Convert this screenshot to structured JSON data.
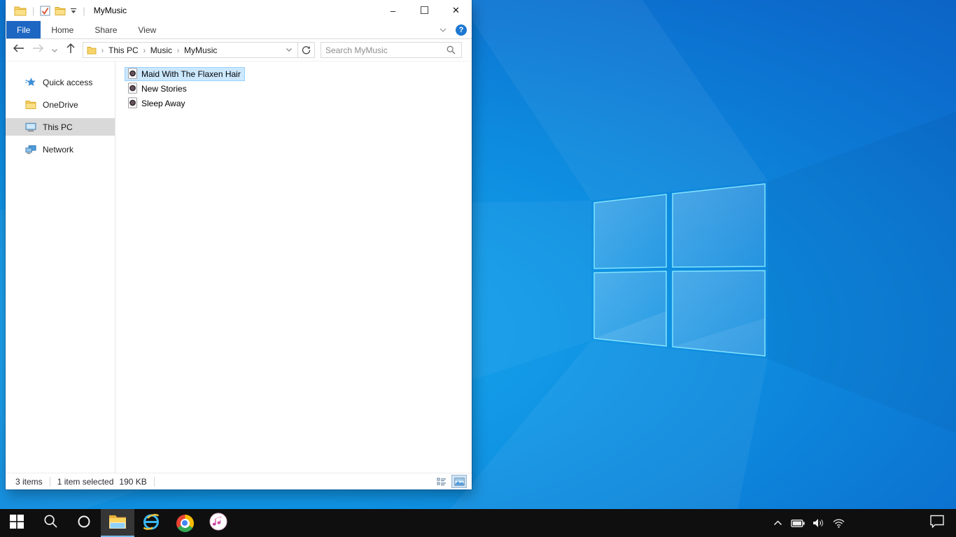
{
  "window": {
    "title": "MyMusic",
    "quick_access_toolbar": {
      "icons": [
        "file-explorer-icon",
        "properties-check-icon",
        "new-folder-icon",
        "qat-dropdown-icon"
      ]
    },
    "controls": {
      "minimize": "–",
      "maximize": "☐",
      "close": "✕"
    }
  },
  "ribbon": {
    "tabs": [
      "File",
      "Home",
      "Share",
      "View"
    ],
    "active_tab": "File",
    "right_icons": [
      "collapse-ribbon-chevron-icon",
      "help-icon"
    ],
    "help_label": "?"
  },
  "navigation": {
    "icons": [
      "back-icon",
      "forward-icon",
      "recent-locations-chevron-icon",
      "up-icon"
    ]
  },
  "address_bar": {
    "crumbs": [
      "This PC",
      "Music",
      "MyMusic"
    ],
    "separator": "›",
    "icons": [
      "folder-icon",
      "dropdown-chevron-icon",
      "refresh-icon"
    ]
  },
  "search": {
    "placeholder": "Search MyMusic",
    "icon": "magnifier-icon"
  },
  "sidebar": {
    "items": [
      {
        "label": "Quick access",
        "icon": "quick-access-star-icon",
        "selected": false
      },
      {
        "label": "OneDrive",
        "icon": "onedrive-folder-icon",
        "selected": false
      },
      {
        "label": "This PC",
        "icon": "this-pc-monitor-icon",
        "selected": true
      },
      {
        "label": "Network",
        "icon": "network-icon",
        "selected": false
      }
    ]
  },
  "file_list": {
    "items": [
      {
        "name": "Maid With The Flaxen Hair",
        "icon": "audio-file-icon",
        "selected": true
      },
      {
        "name": "New Stories",
        "icon": "audio-file-icon",
        "selected": false
      },
      {
        "name": "Sleep Away",
        "icon": "audio-file-icon",
        "selected": false
      }
    ]
  },
  "status_bar": {
    "items_count": "3 items",
    "selection_info": "1 item selected",
    "selection_size": "190 KB",
    "view_buttons": [
      "details-view-icon",
      "thumbnails-view-icon"
    ],
    "active_view": "thumbnails"
  },
  "taskbar": {
    "buttons": [
      {
        "name": "start",
        "active": false
      },
      {
        "name": "search",
        "active": false
      },
      {
        "name": "cortana",
        "active": false
      },
      {
        "name": "file-explorer",
        "active": true
      },
      {
        "name": "internet-explorer",
        "active": false
      },
      {
        "name": "chrome",
        "active": false
      },
      {
        "name": "itunes",
        "active": false
      }
    ],
    "tray_icons": [
      "chevron-up-icon",
      "battery-icon",
      "volume-icon",
      "wifi-icon"
    ],
    "action_center_icon": "notifications-icon"
  },
  "colors": {
    "ribbon_active_tab": "#1d66c2",
    "selection_bg": "#cce8ff",
    "selection_border": "#99d1ff",
    "sidebar_selected_bg": "#d9d9d9",
    "taskbar_bg": "#0f0f0f",
    "taskbar_active_underline": "#76b9ed",
    "help_blue": "#1d78d2",
    "wallpaper_light": "#18abf1",
    "wallpaper_dark": "#0a55b6"
  }
}
